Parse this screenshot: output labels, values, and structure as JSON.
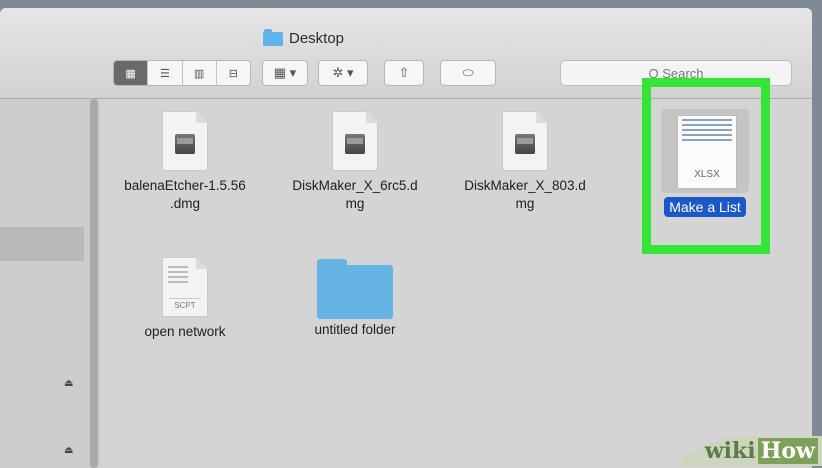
{
  "window": {
    "title": "Desktop"
  },
  "toolbar": {
    "view_icons": [
      "icon-view-icon",
      "list-view-icon",
      "column-view-icon",
      "gallery-view-icon"
    ],
    "arrange_label": "▦ ▾",
    "action_label": "✲ ▾",
    "share_icon": "share-icon",
    "tag_icon": "tag-icon",
    "search_placeholder": "Q Search"
  },
  "files": [
    {
      "name": "balenaEtcher-1.5.56 .dmg",
      "line1": "balenaEtcher-1.5.56",
      "line2": ".dmg",
      "icon": "disk-image-icon"
    },
    {
      "name": "DiskMaker_X_6rc5.d mg",
      "line1": "DiskMaker_X_6rc5.d",
      "line2": "mg",
      "icon": "disk-image-icon"
    },
    {
      "name": "DiskMaker_X_803.d mg",
      "line1": "DiskMaker_X_803.d",
      "line2": "mg",
      "icon": "disk-image-icon"
    },
    {
      "name": "Make a List",
      "line1": "Make a List",
      "icon": "xlsx-icon",
      "badge": "XLSX",
      "selected": true
    },
    {
      "name": "open network",
      "line1": "open network",
      "icon": "script-icon",
      "badge": "SCPT"
    },
    {
      "name": "untitled folder",
      "line1": "untitled folder",
      "icon": "folder-icon"
    }
  ],
  "sidebar": {
    "eject_glyph": "⏏"
  },
  "watermark": {
    "part1": "wiki",
    "part2": "How"
  },
  "colors": {
    "highlight": "#35e434",
    "selection": "#1b58c9",
    "folder": "#65b4e3"
  }
}
